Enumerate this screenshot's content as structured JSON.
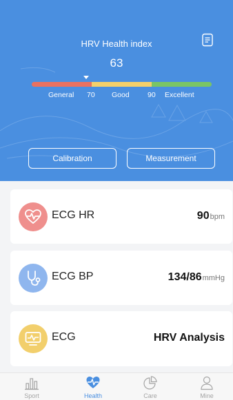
{
  "header": {
    "title": "HRV Health index",
    "value": "63",
    "scale": {
      "labels": [
        "General",
        "70",
        "Good",
        "90",
        "Excellent"
      ],
      "colors": [
        "#e9715f",
        "#f4d06a",
        "#7ac565"
      ],
      "marker_value": 63
    },
    "buttons": {
      "calibration": "Calibration",
      "measurement": "Measurement"
    }
  },
  "cards": {
    "hr": {
      "title": "ECG HR",
      "value": "90",
      "unit": "bpm",
      "icon": "heart-pulse-icon",
      "color": "#ef8f8d"
    },
    "bp": {
      "title": "ECG BP",
      "value": "134/86",
      "unit": "mmHg",
      "icon": "stethoscope-icon",
      "color": "#8fb6ee"
    },
    "ecg": {
      "title": "ECG",
      "value": "HRV Analysis",
      "icon": "ecg-monitor-icon",
      "color": "#f2cf6c"
    }
  },
  "tabs": {
    "sport": "Sport",
    "health": "Health",
    "care": "Care",
    "mine": "Mine",
    "active": "health",
    "active_color": "#4a8fe0"
  }
}
